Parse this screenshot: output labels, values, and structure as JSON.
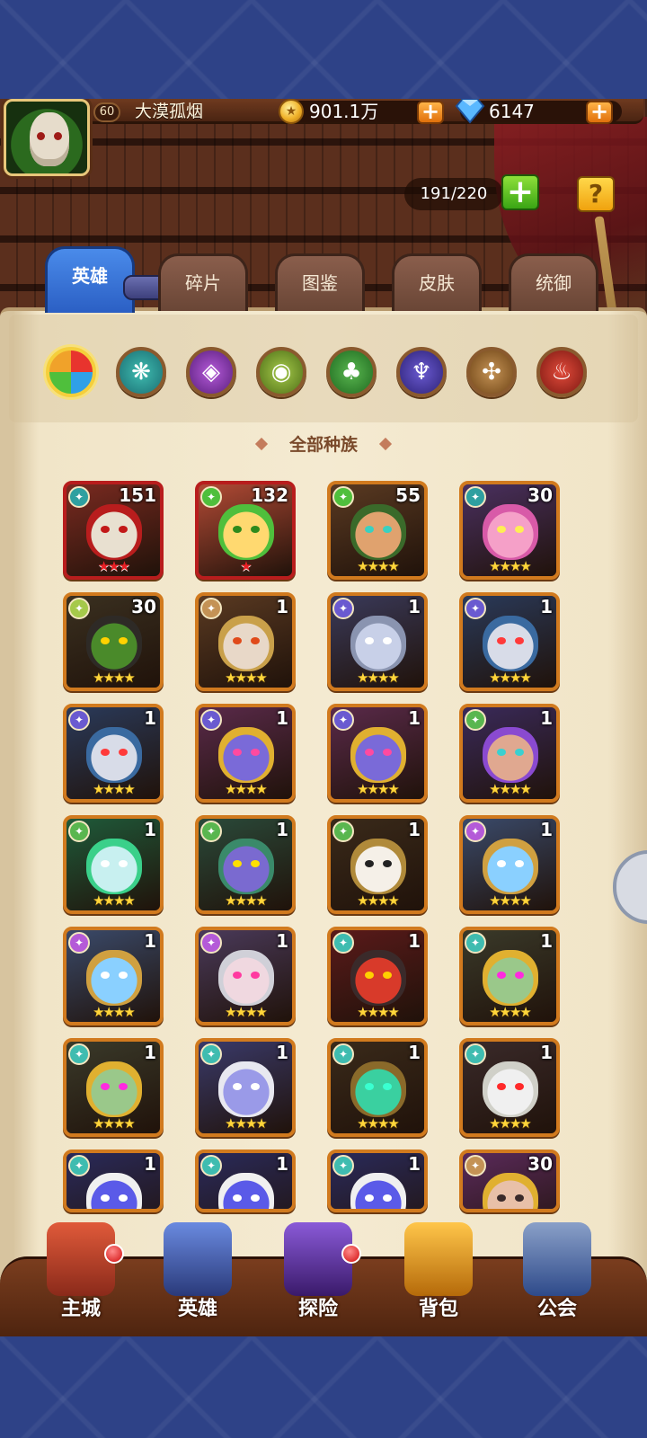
{
  "player": {
    "level": "60",
    "name": "大漠孤烟",
    "gold": "901.1万",
    "gems": "6147",
    "gold_plus": "+",
    "gem_plus": "+"
  },
  "capacity": {
    "value": "191/220",
    "add": "+"
  },
  "help": "?",
  "tabs": [
    {
      "label": "英雄",
      "active": true
    },
    {
      "label": "碎片"
    },
    {
      "label": "图鉴"
    },
    {
      "label": "皮肤"
    },
    {
      "label": "统御"
    }
  ],
  "race_filters": [
    "all",
    "water",
    "arcane",
    "nature-eye",
    "forest",
    "shadow",
    "light",
    "fire"
  ],
  "section_title": "全部种族",
  "heroes": [
    {
      "level": "151",
      "stars": "★★★",
      "star_color": "red"
    },
    {
      "level": "132",
      "stars": "★",
      "star_color": "red"
    },
    {
      "level": "55",
      "stars": "★★★★"
    },
    {
      "level": "30",
      "stars": "★★★★"
    },
    {
      "level": "30",
      "stars": "★★★★"
    },
    {
      "level": "1",
      "stars": "★★★★"
    },
    {
      "level": "1",
      "stars": "★★★★"
    },
    {
      "level": "1",
      "stars": "★★★★"
    },
    {
      "level": "1",
      "stars": "★★★★"
    },
    {
      "level": "1",
      "stars": "★★★★"
    },
    {
      "level": "1",
      "stars": "★★★★"
    },
    {
      "level": "1",
      "stars": "★★★★"
    },
    {
      "level": "1",
      "stars": "★★★★"
    },
    {
      "level": "1",
      "stars": "★★★★"
    },
    {
      "level": "1",
      "stars": "★★★★"
    },
    {
      "level": "1",
      "stars": "★★★★"
    },
    {
      "level": "1",
      "stars": "★★★★"
    },
    {
      "level": "1",
      "stars": "★★★★"
    },
    {
      "level": "1",
      "stars": "★★★★"
    },
    {
      "level": "1",
      "stars": "★★★★"
    },
    {
      "level": "1",
      "stars": "★★★★"
    },
    {
      "level": "1",
      "stars": "★★★★"
    },
    {
      "level": "1",
      "stars": "★★★★"
    },
    {
      "level": "1",
      "stars": "★★★★"
    },
    {
      "level": "1",
      "stars": ""
    },
    {
      "level": "1",
      "stars": ""
    },
    {
      "level": "1",
      "stars": ""
    },
    {
      "level": "30",
      "stars": ""
    }
  ],
  "nav": [
    {
      "label": "主城",
      "icon": "castle-icon",
      "badge": true
    },
    {
      "label": "英雄",
      "icon": "hero-icon",
      "badge": false
    },
    {
      "label": "探险",
      "icon": "portal-icon",
      "badge": true
    },
    {
      "label": "背包",
      "icon": "backpack-icon",
      "badge": false
    },
    {
      "label": "公会",
      "icon": "guild-icon",
      "badge": false
    }
  ]
}
